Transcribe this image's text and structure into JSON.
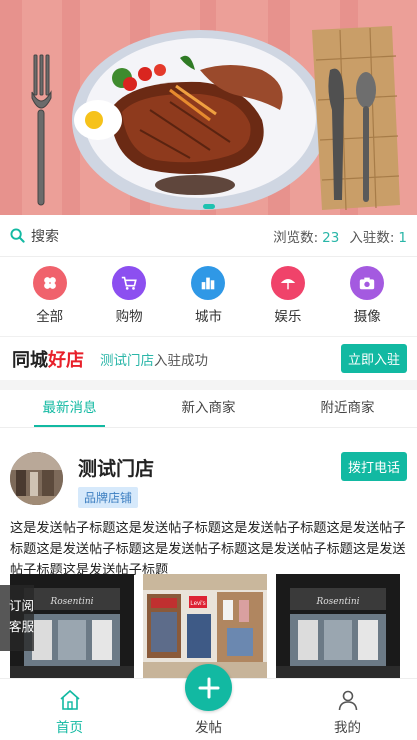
{
  "search": {
    "label": "搜索"
  },
  "stats": {
    "views_label": "浏览数:",
    "views": "23",
    "members_label": "入驻数:",
    "members": "1"
  },
  "categories": [
    {
      "label": "全部",
      "icon": "clover-icon",
      "color": "#f0626c"
    },
    {
      "label": "购物",
      "icon": "cart-icon",
      "color": "#8c4ff0"
    },
    {
      "label": "城市",
      "icon": "city-icon",
      "color": "#2f98e6"
    },
    {
      "label": "娱乐",
      "icon": "umbrella-icon",
      "color": "#f0436a"
    },
    {
      "label": "摄像",
      "icon": "camera-icon",
      "color": "#a45ae0"
    }
  ],
  "notice": {
    "brand_black": "同城",
    "brand_red": "好店",
    "store": "测试门店",
    "msg": "入驻成功",
    "join_label": "立即入驻"
  },
  "tabs": [
    {
      "label": "最新消息"
    },
    {
      "label": "新入商家"
    },
    {
      "label": "附近商家"
    }
  ],
  "post": {
    "store_name": "测试门店",
    "tag": "品牌店铺",
    "call_label": "拨打电话",
    "text": "这是发送帖子标题这是发送帖子标题这是发送帖子标题这是发送帖子标题这是发送帖子标题这是发送帖子标题这是发送帖子标题这是发送帖子标题这是发送帖子标题"
  },
  "side": {
    "line1": "订阅",
    "line2": "客服"
  },
  "nav": {
    "home": "首页",
    "post": "发帖",
    "mine": "我的"
  },
  "colors": {
    "accent": "#12b9a2",
    "red": "#e8202a"
  }
}
